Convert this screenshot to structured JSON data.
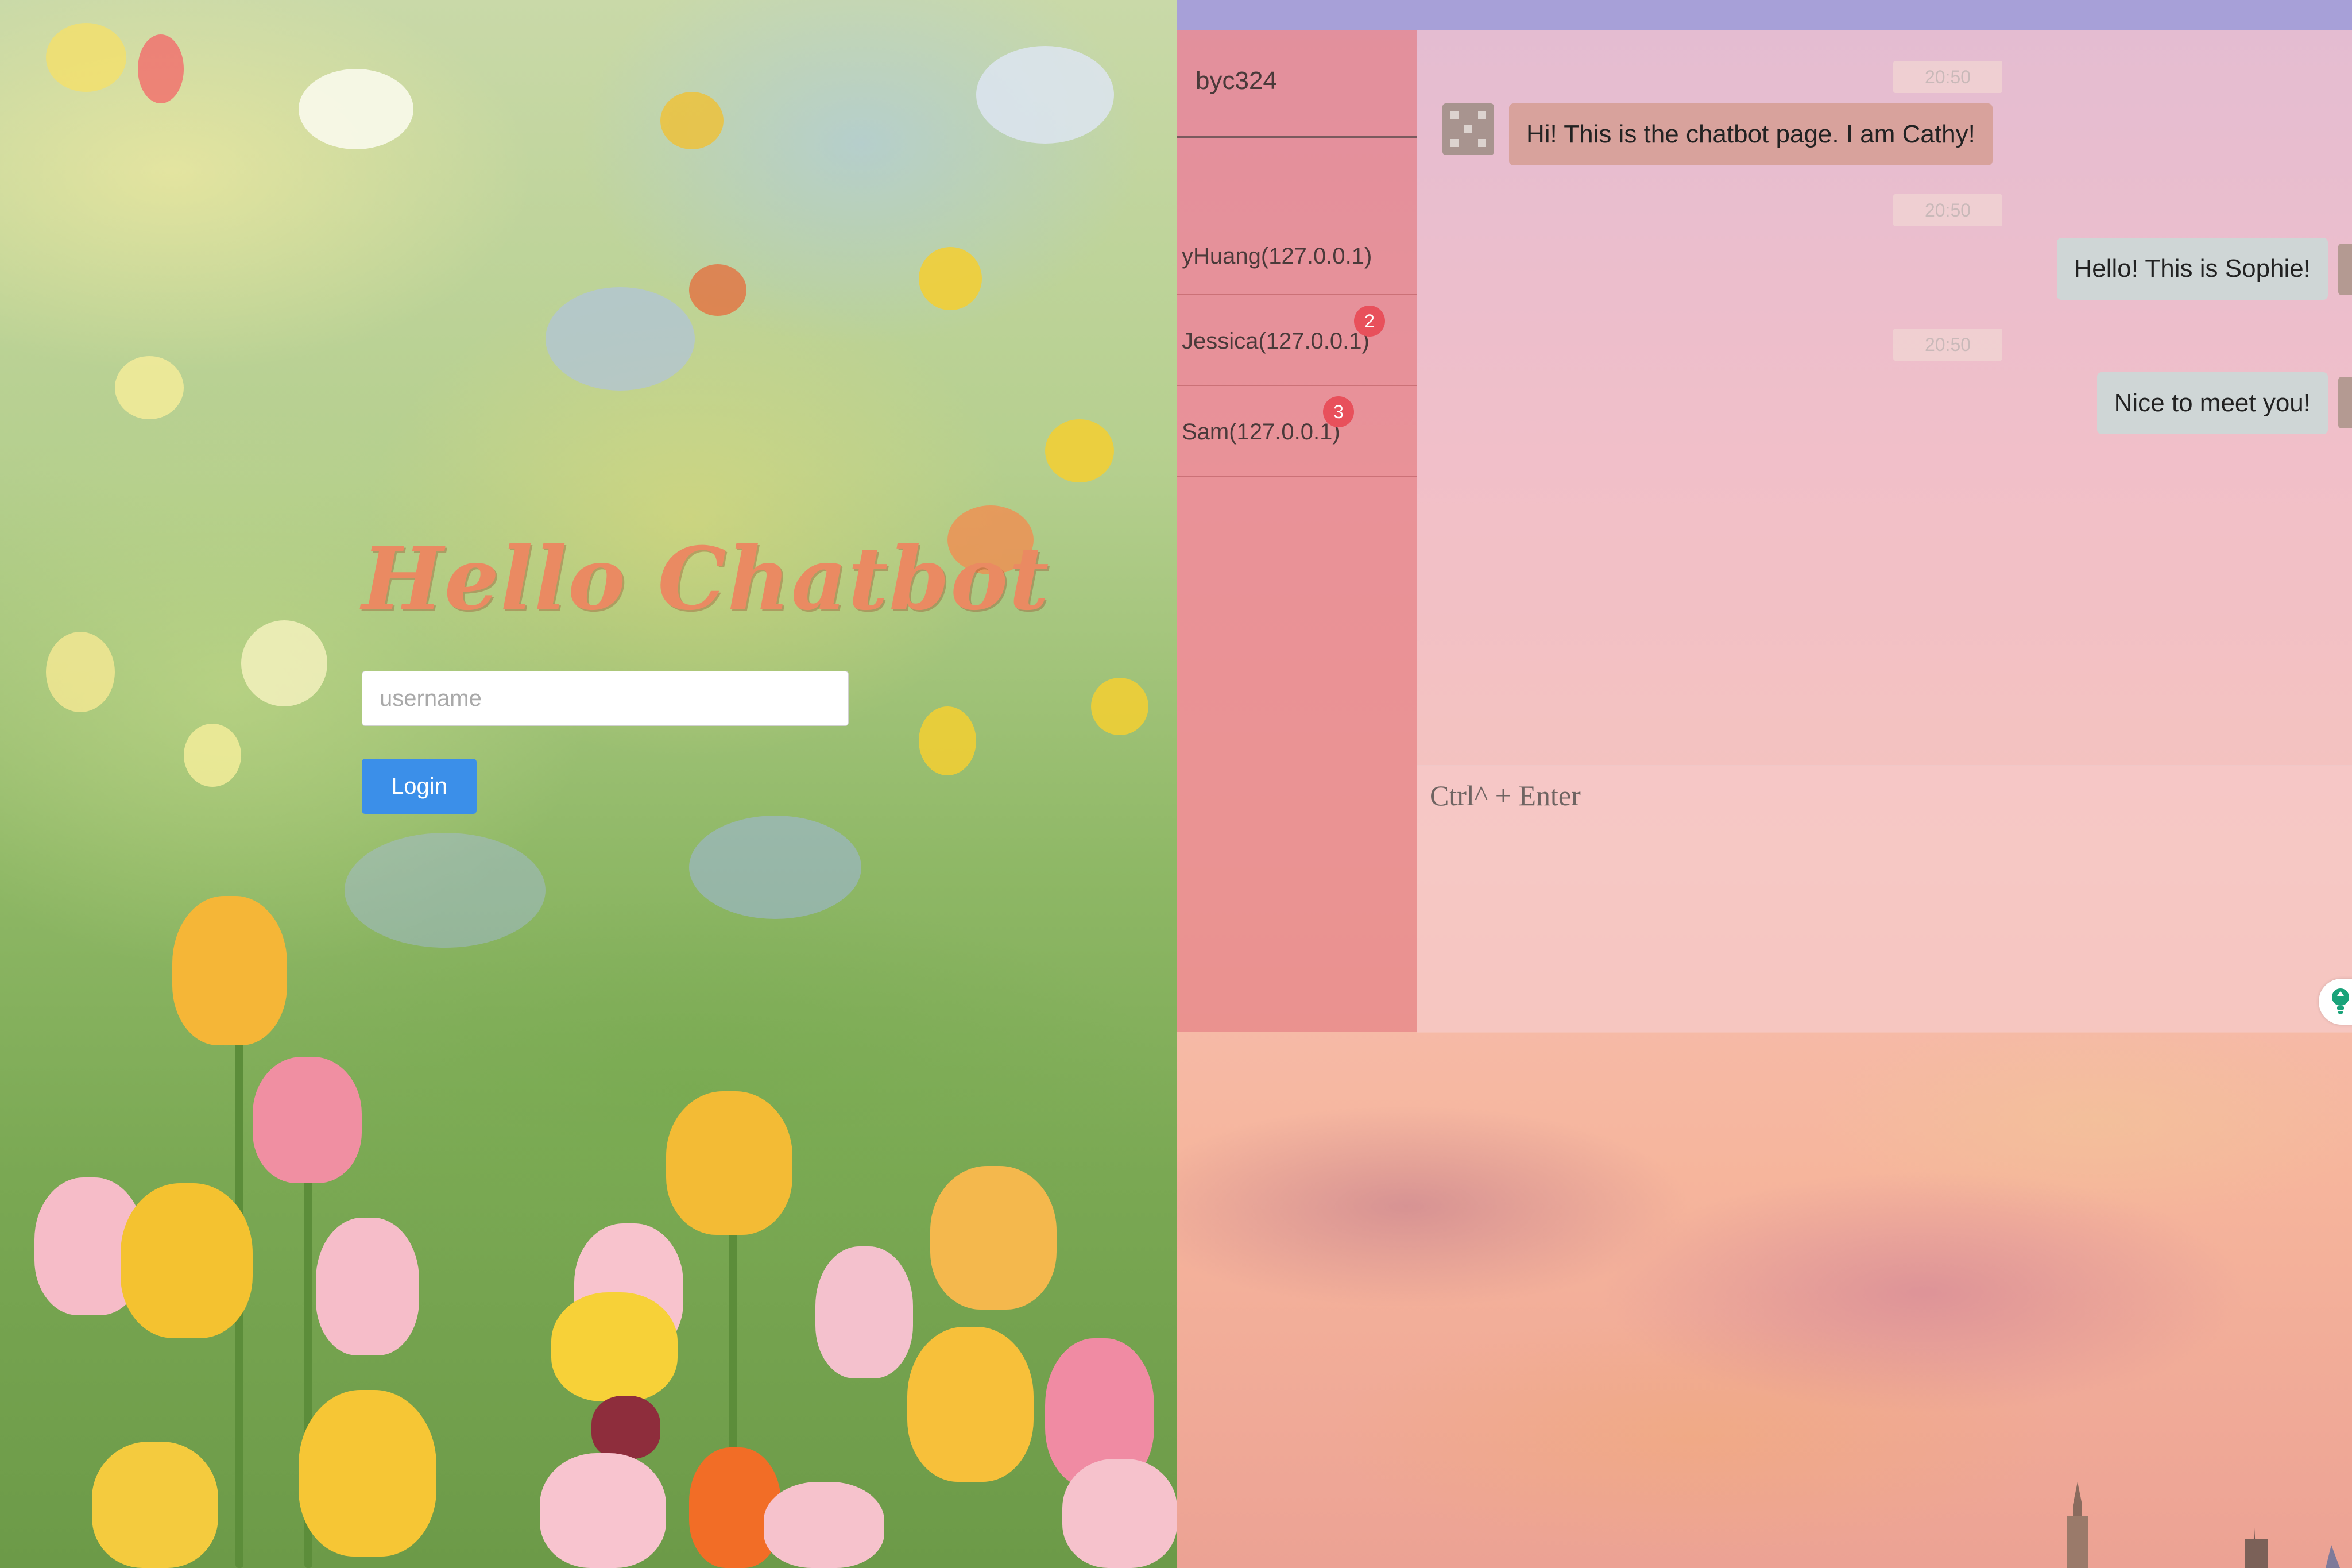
{
  "login": {
    "title": "Hello Chatbot",
    "username_placeholder": "username",
    "username_value": "",
    "login_label": "Login"
  },
  "chat": {
    "current_user": "byc324",
    "contacts": [
      {
        "label": "yHuang(127.0.0.1)",
        "badge": ""
      },
      {
        "label": "Jessica(127.0.0.1)",
        "badge": "2"
      },
      {
        "label": "Sam(127.0.0.1)",
        "badge": "3"
      }
    ],
    "messages": [
      {
        "time": "20:50",
        "text": "Hi! This is the chatbot page. I am Cathy!",
        "direction": "incoming"
      },
      {
        "time": "20:50",
        "text": "Hello! This is Sophie!",
        "direction": "outgoing"
      },
      {
        "time": "20:50",
        "text": "Nice to meet you!",
        "direction": "outgoing"
      }
    ],
    "composer_placeholder": "Ctrl^ + Enter",
    "send_icon": "lightbulb-icon"
  },
  "colors": {
    "login_button": "#3b8fe9",
    "title": "#ea8a62",
    "badge": "#e8505b",
    "sidebar": "#e6828a",
    "top_bar": "#a7a0d8"
  }
}
